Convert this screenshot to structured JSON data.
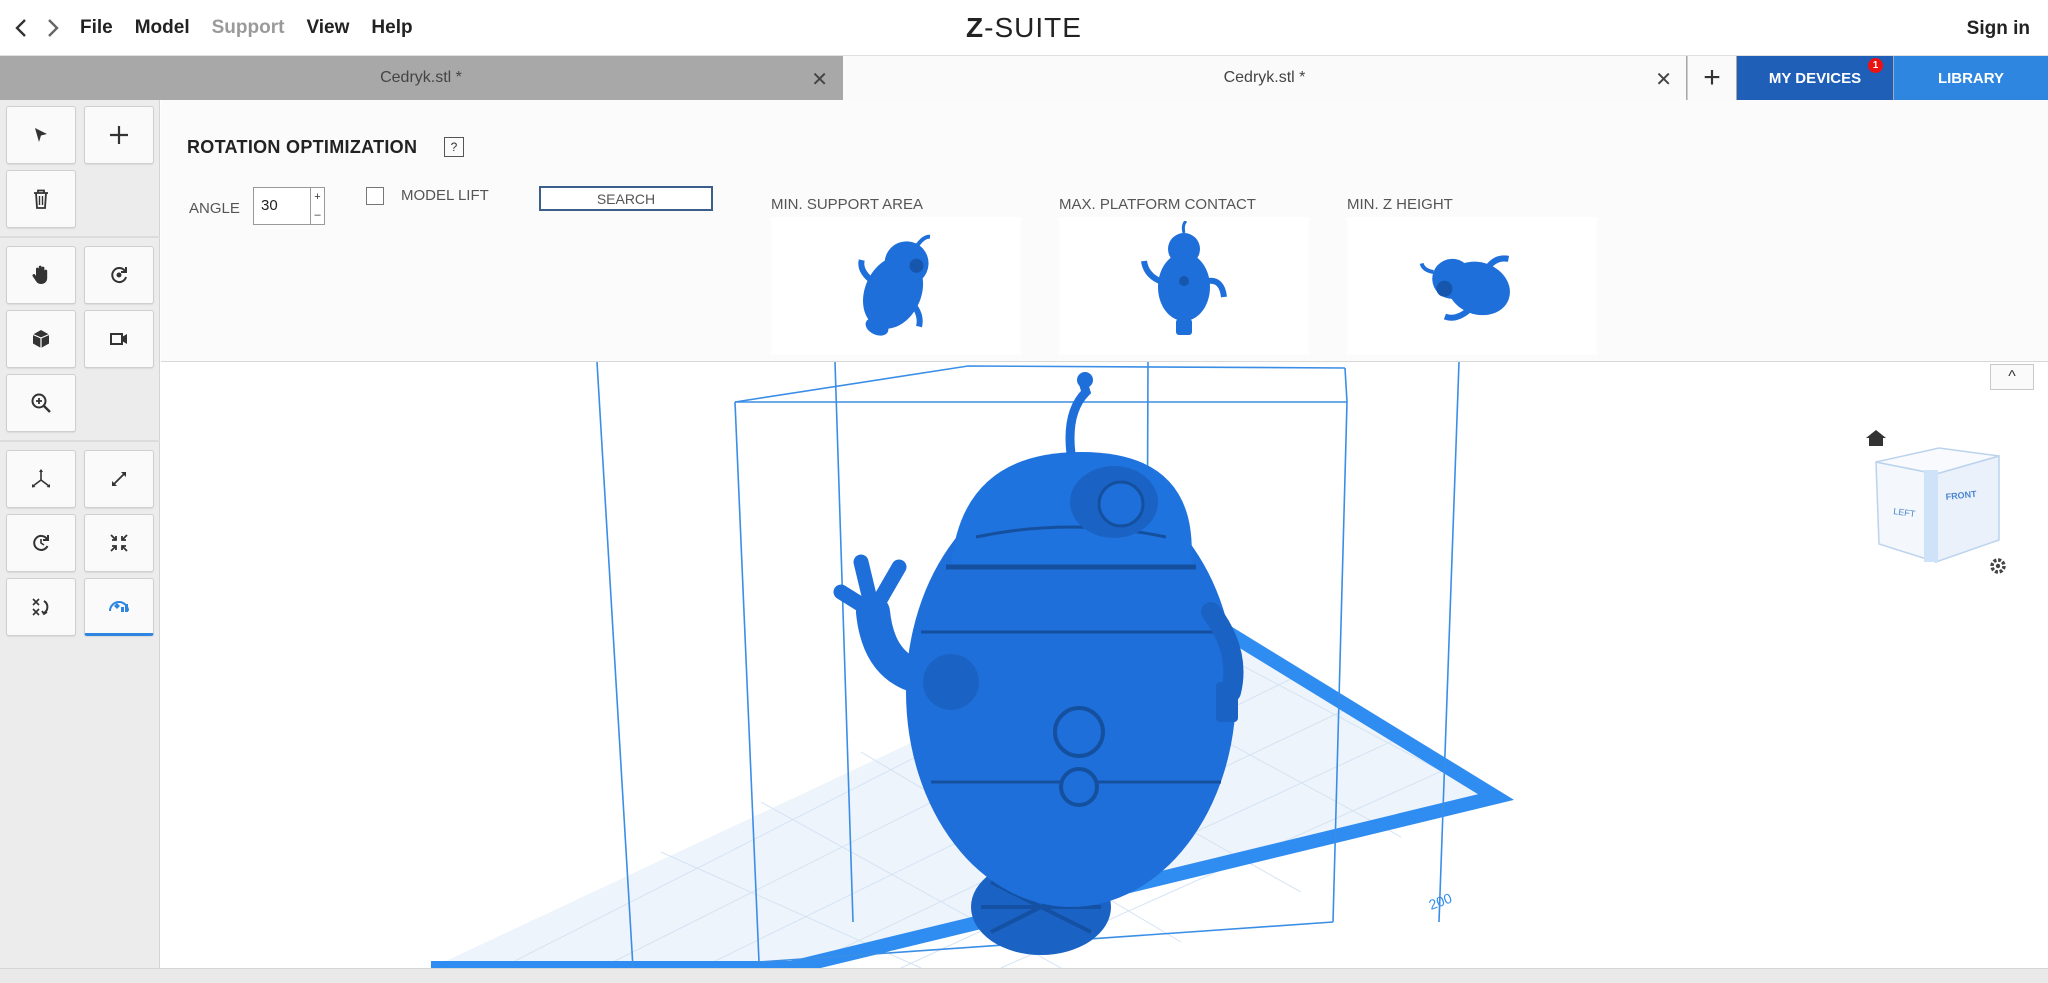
{
  "titlebar": {
    "app_title_prefix": "Z",
    "app_title_suffix": "-SUITE",
    "menu": [
      {
        "label": "File",
        "enabled": true
      },
      {
        "label": "Model",
        "enabled": true
      },
      {
        "label": "Support",
        "enabled": false
      },
      {
        "label": "View",
        "enabled": true
      },
      {
        "label": "Help",
        "enabled": true
      }
    ],
    "sign_in": "Sign in"
  },
  "tabs": {
    "items": [
      {
        "label": "Cedryk.stl *",
        "active": false
      },
      {
        "label": "Cedryk.stl *",
        "active": true
      }
    ],
    "add_label": "+",
    "my_devices": "MY DEVICES",
    "my_devices_badge": "1",
    "library": "LIBRARY"
  },
  "toolbar": {
    "tools": [
      "select-arrow",
      "add",
      "delete",
      "pan",
      "orbit",
      "view-cube",
      "camera",
      "zoom",
      "move",
      "scale",
      "rotate",
      "fit",
      "mirror",
      "rotation-optimization"
    ],
    "active_tool": "rotation-optimization"
  },
  "rotation_panel": {
    "title": "ROTATION OPTIMIZATION",
    "help": "?",
    "angle_label": "ANGLE",
    "angle_value": "30",
    "stepper_up": "+",
    "stepper_down": "–",
    "model_lift_label": "MODEL LIFT",
    "model_lift_checked": false,
    "search_label": "SEARCH",
    "options": [
      {
        "label": "MIN. SUPPORT AREA"
      },
      {
        "label": "MAX. PLATFORM CONTACT"
      },
      {
        "label": "MIN. Z HEIGHT"
      }
    ]
  },
  "viewport": {
    "collapse_label": "^",
    "view_cube_faces": {
      "left": "LEFT",
      "front": "FRONT"
    },
    "model_color": "#1e6fd9",
    "platform_color": "#2f8cf0",
    "wireframe_color": "#3b8ee6"
  }
}
